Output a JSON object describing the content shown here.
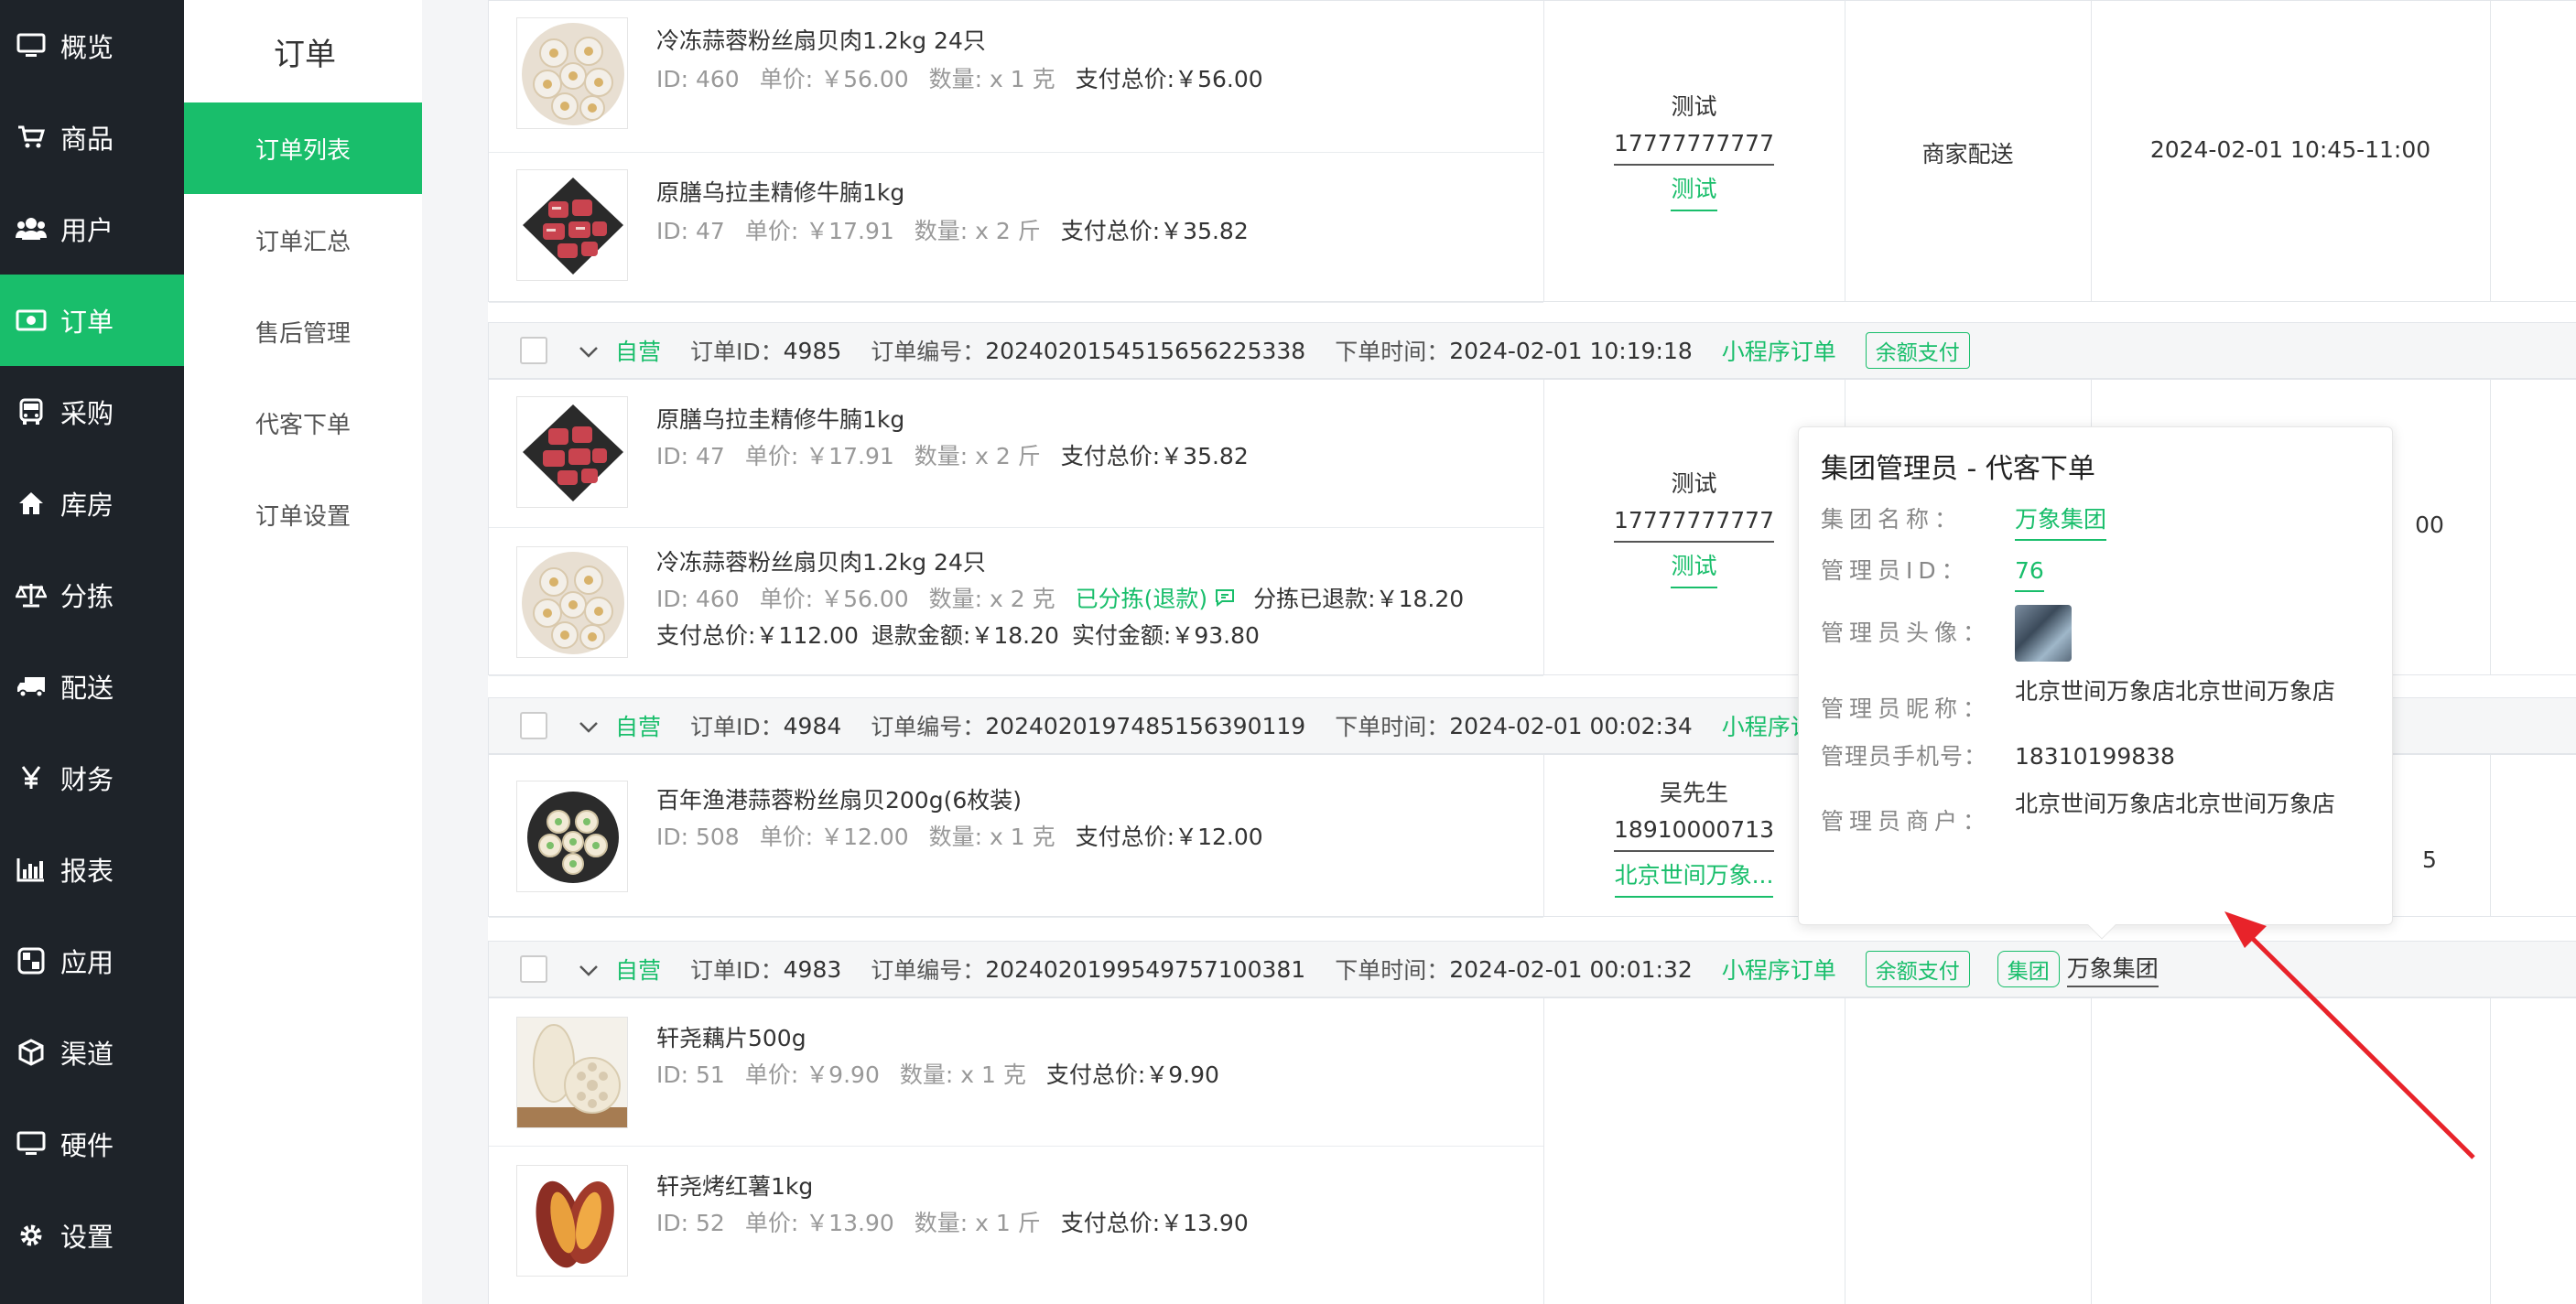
{
  "nav": {
    "items": [
      {
        "label": "概览",
        "icon": "monitor-icon"
      },
      {
        "label": "商品",
        "icon": "cart-icon"
      },
      {
        "label": "用户",
        "icon": "users-icon"
      },
      {
        "label": "订单",
        "icon": "money-icon",
        "active": true
      },
      {
        "label": "采购",
        "icon": "bus-icon"
      },
      {
        "label": "库房",
        "icon": "home-icon"
      },
      {
        "label": "分拣",
        "icon": "scale-icon"
      },
      {
        "label": "配送",
        "icon": "truck-icon"
      },
      {
        "label": "财务",
        "icon": "yen-icon"
      },
      {
        "label": "报表",
        "icon": "bar-chart-icon"
      },
      {
        "label": "应用",
        "icon": "apps-icon"
      },
      {
        "label": "渠道",
        "icon": "cube-icon"
      },
      {
        "label": "硬件",
        "icon": "monitor-icon"
      },
      {
        "label": "设置",
        "icon": "gear-icon"
      }
    ]
  },
  "sub": {
    "title": "订单",
    "items": [
      {
        "label": "订单列表",
        "active": true
      },
      {
        "label": "订单汇总"
      },
      {
        "label": "售后管理"
      },
      {
        "label": "代客下单"
      },
      {
        "label": "订单设置"
      }
    ]
  },
  "orders": [
    {
      "products": [
        {
          "name": "冷冻蒜蓉粉丝扇贝肉1.2kg 24只",
          "id": "ID: 460",
          "price": "单价: ￥56.00",
          "qty": "数量: x 1 克",
          "total": "支付总价:￥56.00"
        },
        {
          "name": "原膳乌拉圭精修牛腩1kg",
          "id": "ID: 47",
          "price": "单价: ￥17.91",
          "qty": "数量: x 2 斤",
          "total": "支付总价:￥35.82"
        }
      ],
      "contact_name": "测试",
      "phone": "17777777777",
      "store": "测试",
      "delivery": "商家配送",
      "time_window": "2024-02-01 10:45-11:00"
    },
    {
      "head": {
        "type": "自营",
        "id_label": "订单ID：",
        "id": "4985",
        "no_label": "订单编号：",
        "no": "2024020154515656225338",
        "time_label": "下单时间：",
        "time": "2024-02-01 10:19:18",
        "source": "小程序订单",
        "pay_tag": "余额支付"
      },
      "products": [
        {
          "name": "原膳乌拉圭精修牛腩1kg",
          "id": "ID: 47",
          "price": "单价: ￥17.91",
          "qty": "数量: x 2 斤",
          "total": "支付总价:￥35.82"
        },
        {
          "name": "冷冻蒜蓉粉丝扇贝肉1.2kg 24只",
          "id": "ID: 460",
          "price": "单价: ￥56.00",
          "qty": "数量: x 2 克",
          "status": "已分拣(退款)",
          "sort_refund": "分拣已退款:￥18.20",
          "total": "支付总价:￥112.00",
          "refund": "退款金额:￥18.20",
          "actual": "实付金额:￥93.80"
        }
      ],
      "contact_name": "测试",
      "phone": "17777777777",
      "store": "测试",
      "time_tail": "00"
    },
    {
      "head": {
        "type": "自营",
        "id_label": "订单ID：",
        "id": "4984",
        "no_label": "订单编号：",
        "no": "2024020197485156390119",
        "time_label": "下单时间：",
        "time": "2024-02-01 00:02:34",
        "source_partial": "小程序订"
      },
      "products": [
        {
          "name": "百年渔港蒜蓉粉丝扇贝200g(6枚装)",
          "id": "ID: 508",
          "price": "单价: ￥12.00",
          "qty": "数量: x 1 克",
          "total": "支付总价:￥12.00"
        }
      ],
      "contact_name": "吴先生",
      "phone": "18910000713",
      "store": "北京世间万象...",
      "time_tail": "5"
    },
    {
      "head": {
        "type": "自营",
        "id_label": "订单ID：",
        "id": "4983",
        "no_label": "订单编号：",
        "no": "2024020199549757100381",
        "time_label": "下单时间：",
        "time": "2024-02-01 00:01:32",
        "source": "小程序订单",
        "pay_tag": "余额支付",
        "group_tag": "集团",
        "group_name": "万象集团"
      },
      "products": [
        {
          "name": "轩尧藕片500g",
          "id": "ID: 51",
          "price": "单价: ￥9.90",
          "qty": "数量: x 1 克",
          "total": "支付总价:￥9.90"
        },
        {
          "name": "轩尧烤红薯1kg",
          "id": "ID: 52",
          "price": "单价: ￥13.90",
          "qty": "数量: x 1 斤",
          "total": "支付总价:￥13.90"
        }
      ]
    }
  ],
  "popover": {
    "title": "集团管理员 - 代客下单",
    "group_name_label": "集团名称：",
    "group_name": "万象集团",
    "admin_id_label": "管理员ID：",
    "admin_id": "76",
    "avatar_label": "管理员头像：",
    "nickname_label": "管理员昵称：",
    "nickname": "北京世间万象店北京世间万象店",
    "phone_label": "管理员手机号：",
    "phone": "18310199838",
    "merchant_label": "管理员商户：",
    "merchant": "北京世间万象店北京世间万象店"
  },
  "colors": {
    "accent": "#19be6b",
    "nav_bg": "#1e2329",
    "annotation": "#e8232a"
  }
}
